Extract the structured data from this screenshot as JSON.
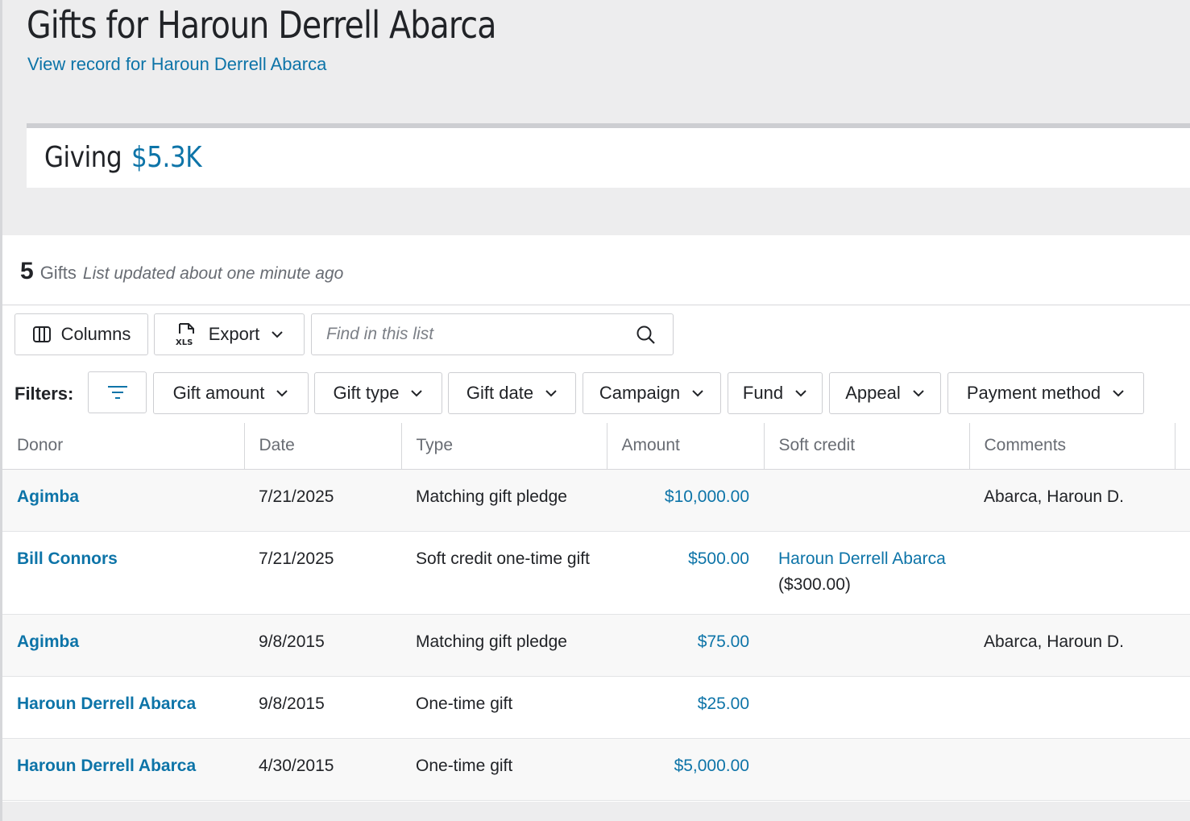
{
  "header": {
    "title": "Gifts for Haroun Derrell Abarca",
    "record_link": "View record for Haroun Derrell Abarca"
  },
  "giving": {
    "label": "Giving",
    "value": "$5.3K"
  },
  "list": {
    "count": "5",
    "count_label": "Gifts",
    "updated_text": "List updated about one minute ago"
  },
  "toolbar": {
    "columns_label": "Columns",
    "export_label": "Export",
    "export_icon_text": "XLS",
    "search_placeholder": "Find in this list"
  },
  "filters": {
    "label": "Filters:",
    "items": [
      "Gift amount",
      "Gift type",
      "Gift date",
      "Campaign",
      "Fund",
      "Appeal",
      "Payment method"
    ]
  },
  "table": {
    "columns": [
      "Donor",
      "Date",
      "Type",
      "Amount",
      "Soft credit",
      "Comments"
    ],
    "rows": [
      {
        "donor": "Agimba",
        "date": "7/21/2025",
        "type": "Matching gift pledge",
        "amount": "$10,000.00",
        "soft_credit_name": "",
        "soft_credit_amount": "",
        "comments": "Abarca, Haroun D."
      },
      {
        "donor": "Bill Connors",
        "date": "7/21/2025",
        "type": "Soft credit one-time gift",
        "amount": "$500.00",
        "soft_credit_name": "Haroun Derrell Abarca",
        "soft_credit_amount": " ($300.00)",
        "comments": ""
      },
      {
        "donor": "Agimba",
        "date": "9/8/2015",
        "type": "Matching gift pledge",
        "amount": "$75.00",
        "soft_credit_name": "",
        "soft_credit_amount": "",
        "comments": "Abarca, Haroun D."
      },
      {
        "donor": "Haroun Derrell Abarca",
        "date": "9/8/2015",
        "type": "One-time gift",
        "amount": "$25.00",
        "soft_credit_name": "",
        "soft_credit_amount": "",
        "comments": ""
      },
      {
        "donor": "Haroun Derrell Abarca",
        "date": "4/30/2015",
        "type": "One-time gift",
        "amount": "$5,000.00",
        "soft_credit_name": "",
        "soft_credit_amount": "",
        "comments": ""
      }
    ]
  },
  "colors": {
    "link": "#0d74a8",
    "text": "#212327",
    "muted": "#686c73",
    "background": "#ededee"
  }
}
